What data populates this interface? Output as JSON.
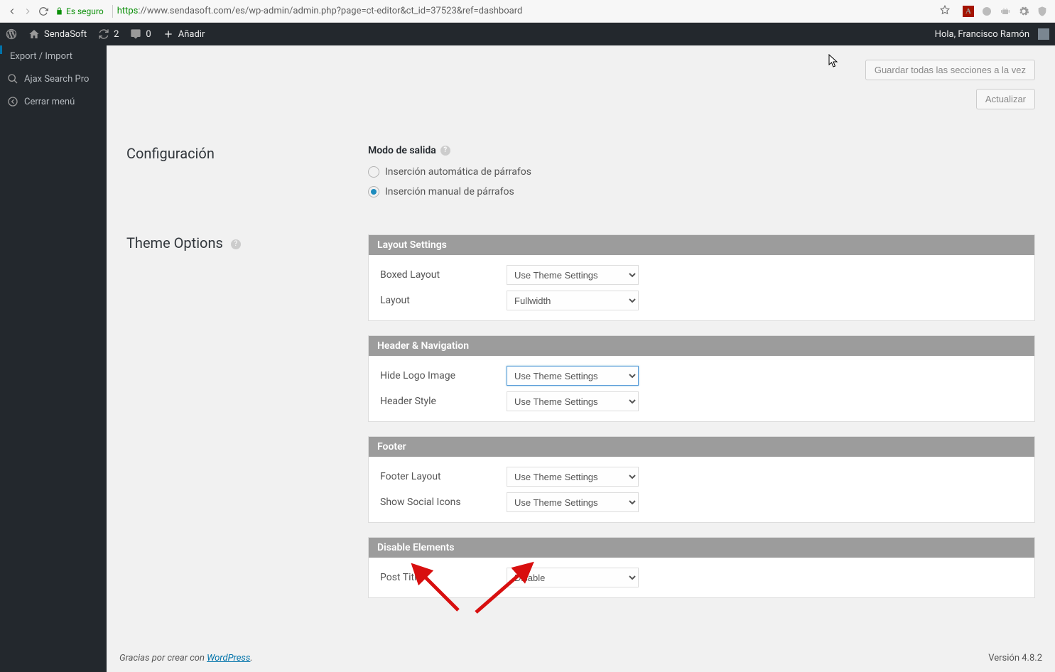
{
  "browser": {
    "secure_label": "Es seguro",
    "url_proto": "https",
    "url_rest": "://www.sendasoft.com/es/wp-admin/admin.php?page=ct-editor&ct_id=37523&ref=dashboard"
  },
  "adminbar": {
    "site_name": "SendaSoft",
    "updates_count": "2",
    "comments_count": "0",
    "add_label": "Añadir",
    "greeting": "Hola, Francisco Ramón"
  },
  "sidebar": {
    "items": [
      {
        "label": "Export / Import"
      },
      {
        "label": "Ajax Search Pro"
      },
      {
        "label": "Cerrar menú"
      }
    ]
  },
  "actions": {
    "save_all_label": "Guardar todas las secciones a la vez",
    "update_label": "Actualizar"
  },
  "config_section": {
    "title": "Configuración",
    "output_mode_label": "Modo de salida",
    "radio_auto_label": "Inserción automática de párrafos",
    "radio_manual_label": "Inserción manual de párrafos"
  },
  "theme_section": {
    "title": "Theme Options",
    "panels": [
      {
        "title": "Layout Settings",
        "rows": [
          {
            "label": "Boxed Layout",
            "value": "Use Theme Settings"
          },
          {
            "label": "Layout",
            "value": "Fullwidth"
          }
        ]
      },
      {
        "title": "Header & Navigation",
        "rows": [
          {
            "label": "Hide Logo Image",
            "value": "Use Theme Settings",
            "focused": true
          },
          {
            "label": "Header Style",
            "value": "Use Theme Settings"
          }
        ]
      },
      {
        "title": "Footer",
        "rows": [
          {
            "label": "Footer Layout",
            "value": "Use Theme Settings"
          },
          {
            "label": "Show Social Icons",
            "value": "Use Theme Settings"
          }
        ]
      },
      {
        "title": "Disable Elements",
        "rows": [
          {
            "label": "Post Title",
            "value": "Disable"
          }
        ]
      }
    ]
  },
  "footer": {
    "thanks_prefix": "Gracias por crear con ",
    "wordpress_link": "WordPress",
    "period": ".",
    "version": "Versión 4.8.2"
  }
}
